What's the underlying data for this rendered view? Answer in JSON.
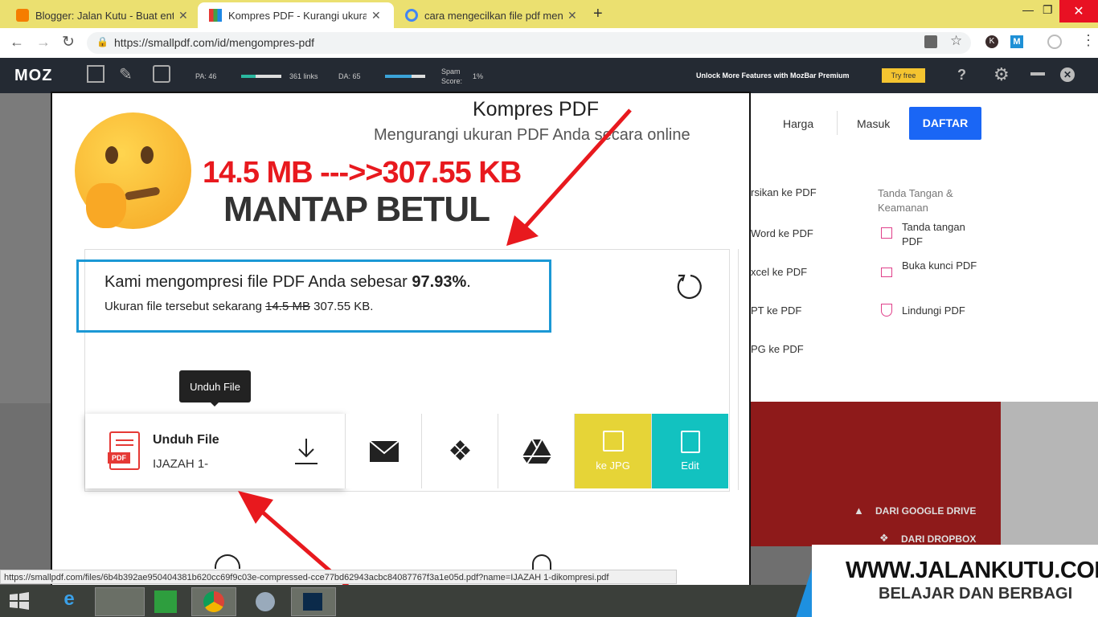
{
  "browser": {
    "tabs": [
      {
        "title": "Blogger: Jalan Kutu - Buat entri",
        "active": false
      },
      {
        "title": "Kompres PDF - Kurangi ukuran P",
        "active": true
      },
      {
        "title": "cara mengecilkan file pdf menjad",
        "active": false
      }
    ],
    "url": "https://smallpdf.com/id/mengompres-pdf",
    "status_url": "https://smallpdf.com/files/6b4b392ae950404381b620cc69f9c03e-compressed-cce77bd62943acbc84087767f3a1e05d.pdf?name=IJAZAH 1-dikompresi.pdf"
  },
  "mozbar": {
    "logo": "MOZ",
    "pa": "PA: 46",
    "links": "361 links",
    "da": "DA: 65",
    "spam_label": "Spam Score:",
    "spam_value": "1%",
    "premium": "Unlock More Features with MozBar Premium",
    "try_free": "Try free"
  },
  "header": {
    "pricing": "Harga",
    "login": "Masuk",
    "signup": "DAFTAR"
  },
  "page": {
    "title": "Kompres PDF",
    "subtitle": "Mengurangi ukuran PDF Anda secara online",
    "overlay_size": "14.5 MB --->>307.55 KB",
    "overlay_caption": "MANTAP BETUL",
    "result_main_prefix": "Kami mengompresi file PDF Anda sebesar ",
    "result_percent": "97.93%",
    "result_main_suffix": ".",
    "result_sub_prefix": "Ukuran file tersebut sekarang ",
    "result_old_size": "14.5 MB",
    "result_new_size": "307.55 KB."
  },
  "download": {
    "tooltip": "Unduh File",
    "title": "Unduh File",
    "filename": "IJAZAH 1-",
    "pdf_label": "PDF"
  },
  "actions": {
    "jpg_label": "ke JPG",
    "edit_label": "Edit"
  },
  "tools_menu": {
    "col1": [
      "rsikan ke PDF",
      "Word ke PDF",
      "xcel ke PDF",
      "PT ke PDF",
      "PG ke PDF"
    ],
    "col2_heading": "Tanda Tangan & Keamanan",
    "col2": [
      "Tanda tangan PDF",
      "Buka kunci PDF",
      "Lindungi PDF"
    ]
  },
  "upload_sources": {
    "google_drive": "DARI GOOGLE DRIVE",
    "dropbox": "DARI DROPBOX"
  },
  "watermark": {
    "site": "WWW.JALANKUTU.COM",
    "tagline": "BELAJAR DAN BERBAGI"
  },
  "colors": {
    "signup_blue": "#1a66f5",
    "jpg_yellow": "#e6d437",
    "edit_teal": "#12c2c0",
    "frame_blue": "#1b98d5",
    "annot_red": "#e8191e"
  }
}
